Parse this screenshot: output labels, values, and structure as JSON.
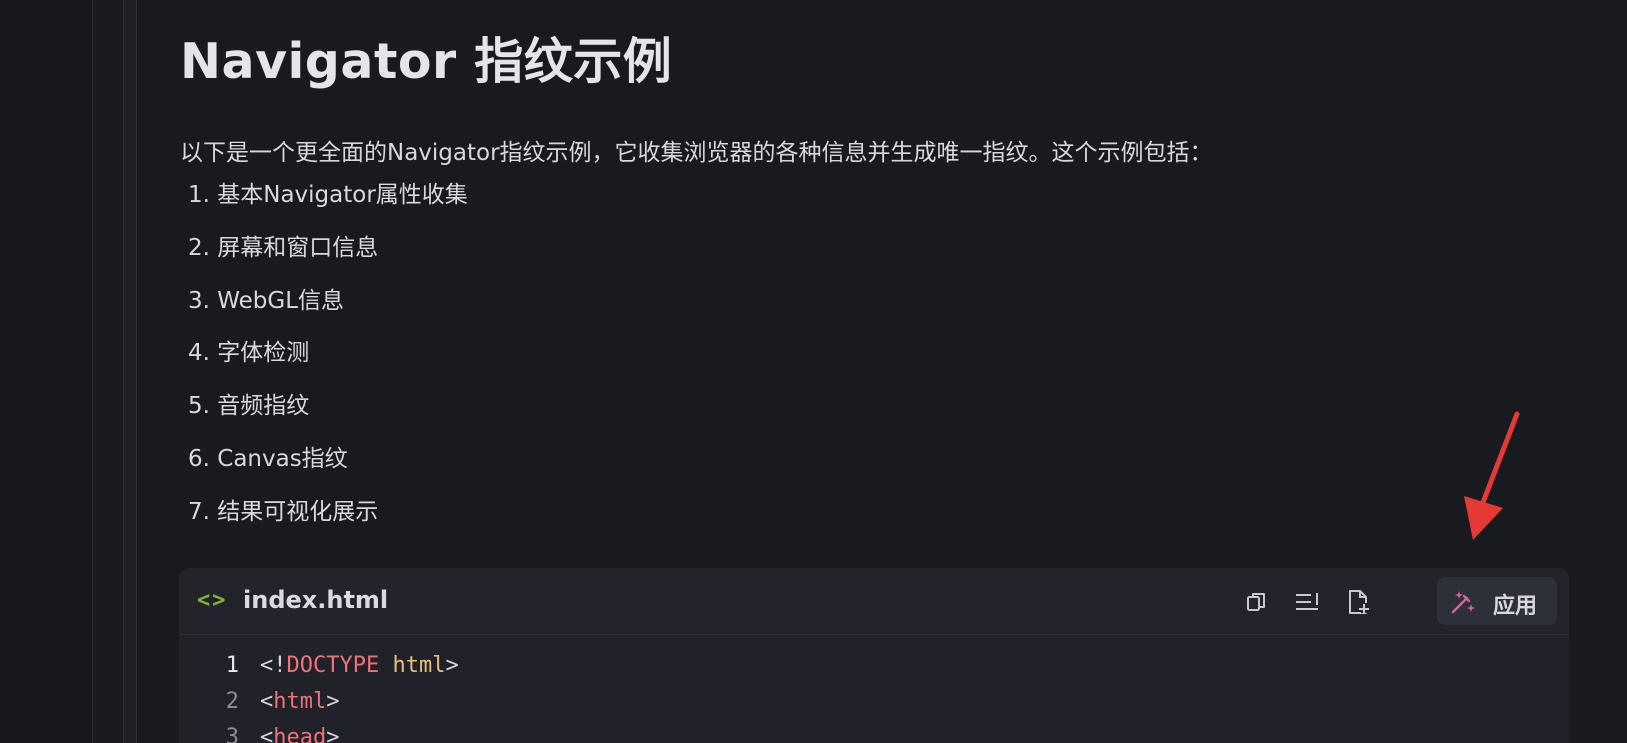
{
  "heading": "Navigator 指纹示例",
  "intro": "以下是一个更全面的Navigator指纹示例，它收集浏览器的各种信息并生成唯一指纹。这个示例包括：",
  "list_items": [
    "1. 基本Navigator属性收集",
    "2. 屏幕和窗口信息",
    "3. WebGL信息",
    "4. 字体检测",
    "5. 音频指纹",
    "6. Canvas指纹",
    "7. 结果可视化展示"
  ],
  "code_block": {
    "icon": "code-brackets-icon",
    "file_name": "index.html",
    "apply_label": "应用",
    "lines": [
      {
        "num": "1",
        "open": "<!",
        "tag": "DOCTYPE",
        "space": " ",
        "attr": "html",
        "close": ">"
      },
      {
        "num": "2",
        "open": "<",
        "tag": "html",
        "space": "",
        "attr": "",
        "close": ">"
      },
      {
        "num": "3",
        "open": "<",
        "tag": "head",
        "space": "",
        "attr": "",
        "close": ">"
      }
    ]
  },
  "colors": {
    "accent_green": "#7fb536",
    "accent_pink": "#e0619d",
    "tag_red": "#f07178",
    "attr_yellow": "#e5c07b",
    "arrow_red": "#e53935"
  }
}
